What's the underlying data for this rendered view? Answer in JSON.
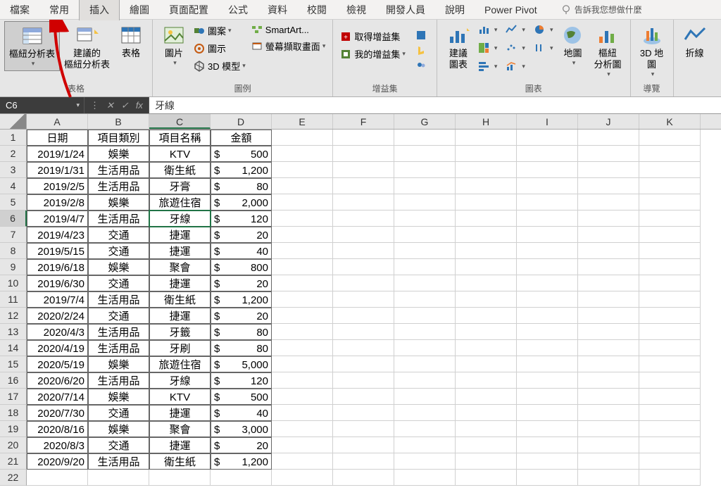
{
  "tabs": [
    "檔案",
    "常用",
    "插入",
    "繪圖",
    "頁面配置",
    "公式",
    "資料",
    "校閱",
    "檢視",
    "開發人員",
    "說明",
    "Power Pivot"
  ],
  "active_tab": 2,
  "tellme": "告訴我您想做什麼",
  "ribbon": {
    "grp_tables": "表格",
    "pivot": "樞紐分析表",
    "rec_pivot": "建議的\n樞紐分析表",
    "table": "表格",
    "grp_illust": "圖例",
    "pic": "圖片",
    "shapes": "圖案",
    "icons": "圖示",
    "models3d": "3D 模型",
    "smartart": "SmartArt...",
    "screenshot": "螢幕擷取畫面",
    "grp_addins": "增益集",
    "get_addins": "取得增益集",
    "my_addins": "我的增益集",
    "grp_charts": "圖表",
    "rec_chart": "建議\n圖表",
    "map": "地圖",
    "pivot_chart": "樞紐\n分析圖",
    "grp_tour": "導覽",
    "map3d": "3D 地\n圖",
    "spark": "折線"
  },
  "namebox": "C6",
  "fx_value": "牙線",
  "col_headers": [
    "A",
    "B",
    "C",
    "D",
    "E",
    "F",
    "G",
    "H",
    "I",
    "J",
    "K"
  ],
  "sel_col": "C",
  "sel_row": 6,
  "headers": [
    "日期",
    "項目類別",
    "項目名稱",
    "金額"
  ],
  "rows": [
    [
      "2019/1/24",
      "娛樂",
      "KTV",
      "$",
      "500"
    ],
    [
      "2019/1/31",
      "生活用品",
      "衛生紙",
      "$",
      "1,200"
    ],
    [
      "2019/2/5",
      "生活用品",
      "牙膏",
      "$",
      "80"
    ],
    [
      "2019/2/8",
      "娛樂",
      "旅遊住宿",
      "$",
      "2,000"
    ],
    [
      "2019/4/7",
      "生活用品",
      "牙線",
      "$",
      "120"
    ],
    [
      "2019/4/23",
      "交通",
      "捷運",
      "$",
      "20"
    ],
    [
      "2019/5/15",
      "交通",
      "捷運",
      "$",
      "40"
    ],
    [
      "2019/6/18",
      "娛樂",
      "聚會",
      "$",
      "800"
    ],
    [
      "2019/6/30",
      "交通",
      "捷運",
      "$",
      "20"
    ],
    [
      "2019/7/4",
      "生活用品",
      "衛生紙",
      "$",
      "1,200"
    ],
    [
      "2020/2/24",
      "交通",
      "捷運",
      "$",
      "20"
    ],
    [
      "2020/4/3",
      "生活用品",
      "牙籤",
      "$",
      "80"
    ],
    [
      "2020/4/19",
      "生活用品",
      "牙刷",
      "$",
      "80"
    ],
    [
      "2020/5/19",
      "娛樂",
      "旅遊住宿",
      "$",
      "5,000"
    ],
    [
      "2020/6/20",
      "生活用品",
      "牙線",
      "$",
      "120"
    ],
    [
      "2020/7/14",
      "娛樂",
      "KTV",
      "$",
      "500"
    ],
    [
      "2020/7/30",
      "交通",
      "捷運",
      "$",
      "40"
    ],
    [
      "2020/8/16",
      "娛樂",
      "聚會",
      "$",
      "3,000"
    ],
    [
      "2020/8/3",
      "交通",
      "捷運",
      "$",
      "20"
    ],
    [
      "2020/9/20",
      "生活用品",
      "衛生紙",
      "$",
      "1,200"
    ]
  ]
}
